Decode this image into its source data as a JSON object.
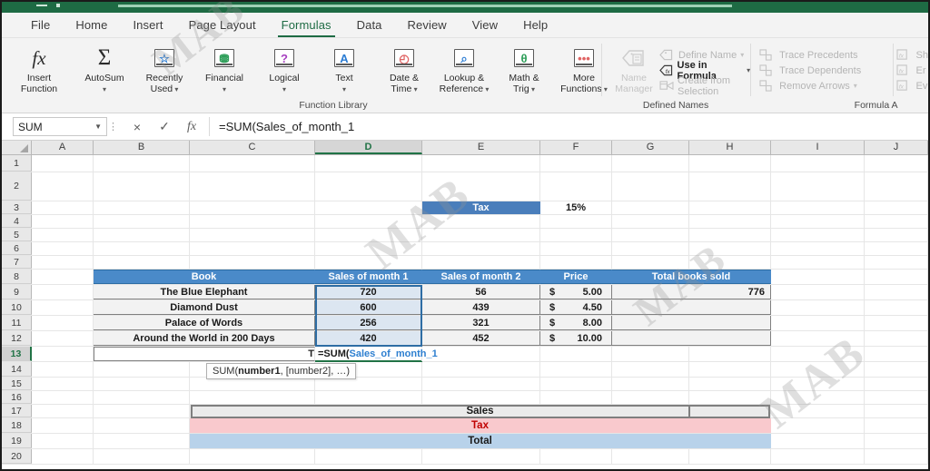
{
  "window": {
    "title_accent": "#1e6b44"
  },
  "tabs": [
    {
      "label": "File",
      "active": false
    },
    {
      "label": "Home",
      "active": false
    },
    {
      "label": "Insert",
      "active": false
    },
    {
      "label": "Page Layout",
      "active": false
    },
    {
      "label": "Formulas",
      "active": true
    },
    {
      "label": "Data",
      "active": false
    },
    {
      "label": "Review",
      "active": false
    },
    {
      "label": "View",
      "active": false
    },
    {
      "label": "Help",
      "active": false
    }
  ],
  "ribbon": {
    "function_library": {
      "group_label": "Function Library",
      "insert_function": {
        "label_line1": "Insert",
        "label_line2": "Function",
        "icon": "fx-icon"
      },
      "buttons": [
        {
          "label_line1": "AutoSum",
          "label_line2": "",
          "icon": "sigma-icon",
          "glyph": "Σ",
          "color": "#2b2b2b",
          "caret": true
        },
        {
          "label_line1": "Recently",
          "label_line2": "Used",
          "icon": "star-book-icon",
          "glyph": "☆",
          "color": "#2b7cd3",
          "caret": true
        },
        {
          "label_line1": "Financial",
          "label_line2": "",
          "icon": "coins-book-icon",
          "glyph": "⛃",
          "color": "#2e9e59",
          "caret": true
        },
        {
          "label_line1": "Logical",
          "label_line2": "",
          "icon": "question-book-icon",
          "glyph": "?",
          "color": "#a63fbf",
          "caret": true
        },
        {
          "label_line1": "Text",
          "label_line2": "",
          "icon": "letter-a-book-icon",
          "glyph": "A",
          "color": "#2b7cd3",
          "caret": true
        },
        {
          "label_line1": "Date &",
          "label_line2": "Time",
          "icon": "clock-book-icon",
          "glyph": "◴",
          "color": "#e06464",
          "caret": true
        },
        {
          "label_line1": "Lookup &",
          "label_line2": "Reference",
          "icon": "magnifier-book-icon",
          "glyph": "⌕",
          "color": "#2b7cd3",
          "caret": true
        },
        {
          "label_line1": "Math &",
          "label_line2": "Trig",
          "icon": "theta-book-icon",
          "glyph": "θ",
          "color": "#2e9e59",
          "caret": true
        },
        {
          "label_line1": "More",
          "label_line2": "Functions",
          "icon": "ellipsis-book-icon",
          "glyph": "•••",
          "color": "#e06464",
          "caret": true
        }
      ]
    },
    "defined_names": {
      "group_label": "Defined Names",
      "name_manager": {
        "label_line1": "Name",
        "label_line2": "Manager",
        "icon": "name-manager-icon",
        "disabled": true
      },
      "items": [
        {
          "label": "Define Name",
          "icon": "tag-icon",
          "caret": true,
          "disabled": true
        },
        {
          "label": "Use in Formula",
          "icon": "fx-tag-icon",
          "caret": true,
          "disabled": false
        },
        {
          "label": "Create from Selection",
          "icon": "create-selection-icon",
          "caret": false,
          "disabled": true
        }
      ]
    },
    "formula_auditing": {
      "group_label": "Formula A",
      "items": [
        {
          "label": "Trace Precedents",
          "icon": "trace-precedents-icon",
          "caret": false
        },
        {
          "label": "Trace Dependents",
          "icon": "trace-dependents-icon",
          "caret": false
        },
        {
          "label": "Remove Arrows",
          "icon": "remove-arrows-icon",
          "caret": true
        }
      ],
      "items_right": [
        {
          "label": "Sh",
          "icon": "show-formulas-icon"
        },
        {
          "label": "Er",
          "icon": "error-checking-icon"
        },
        {
          "label": "Ev",
          "icon": "evaluate-formula-icon"
        }
      ]
    }
  },
  "formula_bar": {
    "name_box_value": "SUM",
    "cancel_icon": "×",
    "enter_icon": "✓",
    "fx_icon": "fx",
    "formula_value": "=SUM(Sales_of_month_1"
  },
  "grid": {
    "columns": [
      "A",
      "B",
      "C",
      "D",
      "E",
      "F",
      "G",
      "H",
      "I",
      "J"
    ],
    "selected_column": "D",
    "selected_row": "13",
    "rows": [
      "1",
      "2",
      "3",
      "4",
      "5",
      "6",
      "7",
      "8",
      "9",
      "10",
      "11",
      "12",
      "13",
      "14",
      "15",
      "16",
      "17",
      "18",
      "19",
      "20"
    ],
    "header_fill": "#4a8ac9",
    "tax_label": "Tax",
    "tax_value": "15%",
    "table": {
      "headers": [
        "Book",
        "Sales of month 1",
        "Sales of month 2",
        "Price",
        "Total books sold"
      ],
      "rows": [
        {
          "book": "The Blue Elephant",
          "m1": "720",
          "m2": "56",
          "price_sym": "$",
          "price": "5.00",
          "total": "776"
        },
        {
          "book": "Diamond Dust",
          "m1": "600",
          "m2": "439",
          "price_sym": "$",
          "price": "4.50",
          "total": ""
        },
        {
          "book": "Palace of Words",
          "m1": "256",
          "m2": "321",
          "price_sym": "$",
          "price": "8.00",
          "total": ""
        },
        {
          "book": "Around the World in 200 Days",
          "m1": "420",
          "m2": "452",
          "price_sym": "$",
          "price": "10.00",
          "total": ""
        }
      ]
    },
    "editing": {
      "prefix_cell_text": "T",
      "formula_text": "=SUM(",
      "formula_arg": "Sales_of_month_1",
      "tooltip_fn": "SUM(",
      "tooltip_arg1": "number1",
      "tooltip_rest": ", [number2], …)"
    },
    "summary_bands": [
      {
        "label": "Sales",
        "fill": "#ebebeb",
        "text_color": "#1a1a1a"
      },
      {
        "label": "Tax",
        "fill": "#f9c9cd",
        "text_color": "#c00000"
      },
      {
        "label": "Total",
        "fill": "#b8d2ea",
        "text_color": "#1a1a1a"
      }
    ]
  },
  "watermarks": [
    "MAB",
    "MAB",
    "MAB",
    "MAB"
  ]
}
